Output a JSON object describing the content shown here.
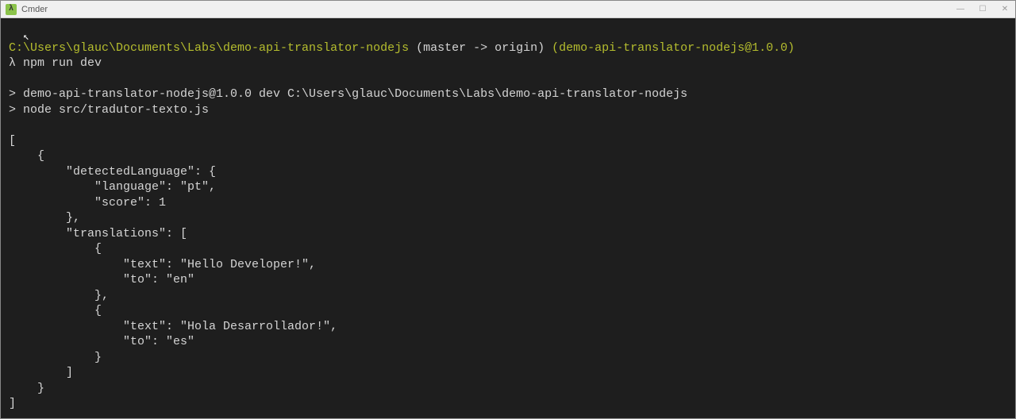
{
  "window": {
    "title": "Cmder"
  },
  "prompt": {
    "path": "C:\\Users\\glauc\\Documents\\Labs\\demo-api-translator-nodejs",
    "branch": " (master -> origin) ",
    "package": "(demo-api-translator-nodejs@1.0.0)",
    "symbol": "λ ",
    "command": "npm run dev"
  },
  "output": {
    "line1": "> demo-api-translator-nodejs@1.0.0 dev C:\\Users\\glauc\\Documents\\Labs\\demo-api-translator-nodejs",
    "line2": "> node src/tradutor-texto.js",
    "json1": "[",
    "json2": "    {",
    "json3": "        \"detectedLanguage\": {",
    "json4": "            \"language\": \"pt\",",
    "json5": "            \"score\": 1",
    "json6": "        },",
    "json7": "        \"translations\": [",
    "json8": "            {",
    "json9": "                \"text\": \"Hello Developer!\",",
    "json10": "                \"to\": \"en\"",
    "json11": "            },",
    "json12": "            {",
    "json13": "                \"text\": \"Hola Desarrollador!\",",
    "json14": "                \"to\": \"es\"",
    "json15": "            }",
    "json16": "        ]",
    "json17": "    }",
    "json18": "]"
  }
}
